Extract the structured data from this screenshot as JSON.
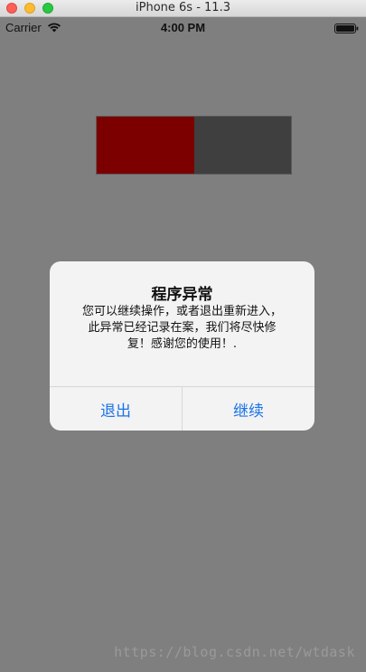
{
  "window": {
    "title": "iPhone 6s - 11.3"
  },
  "statusbar": {
    "carrier": "Carrier",
    "time": "4:00 PM",
    "icons": [
      "wifi-icon",
      "battery-icon"
    ]
  },
  "progress": {
    "value_percent": 50,
    "fill_color": "#7c0000",
    "track_color": "#3f3f3f"
  },
  "alert": {
    "title": "程序异常",
    "message_lines": [
      "您可以继续操作，或者退出重新进入，",
      "此异常已经记录在案，我们将尽快修",
      "复！感谢您的使用！."
    ],
    "buttons": {
      "exit": "退出",
      "continue": "继续"
    },
    "button_color": "#1a73e8"
  },
  "watermark": "https://blog.csdn.net/wtdask"
}
